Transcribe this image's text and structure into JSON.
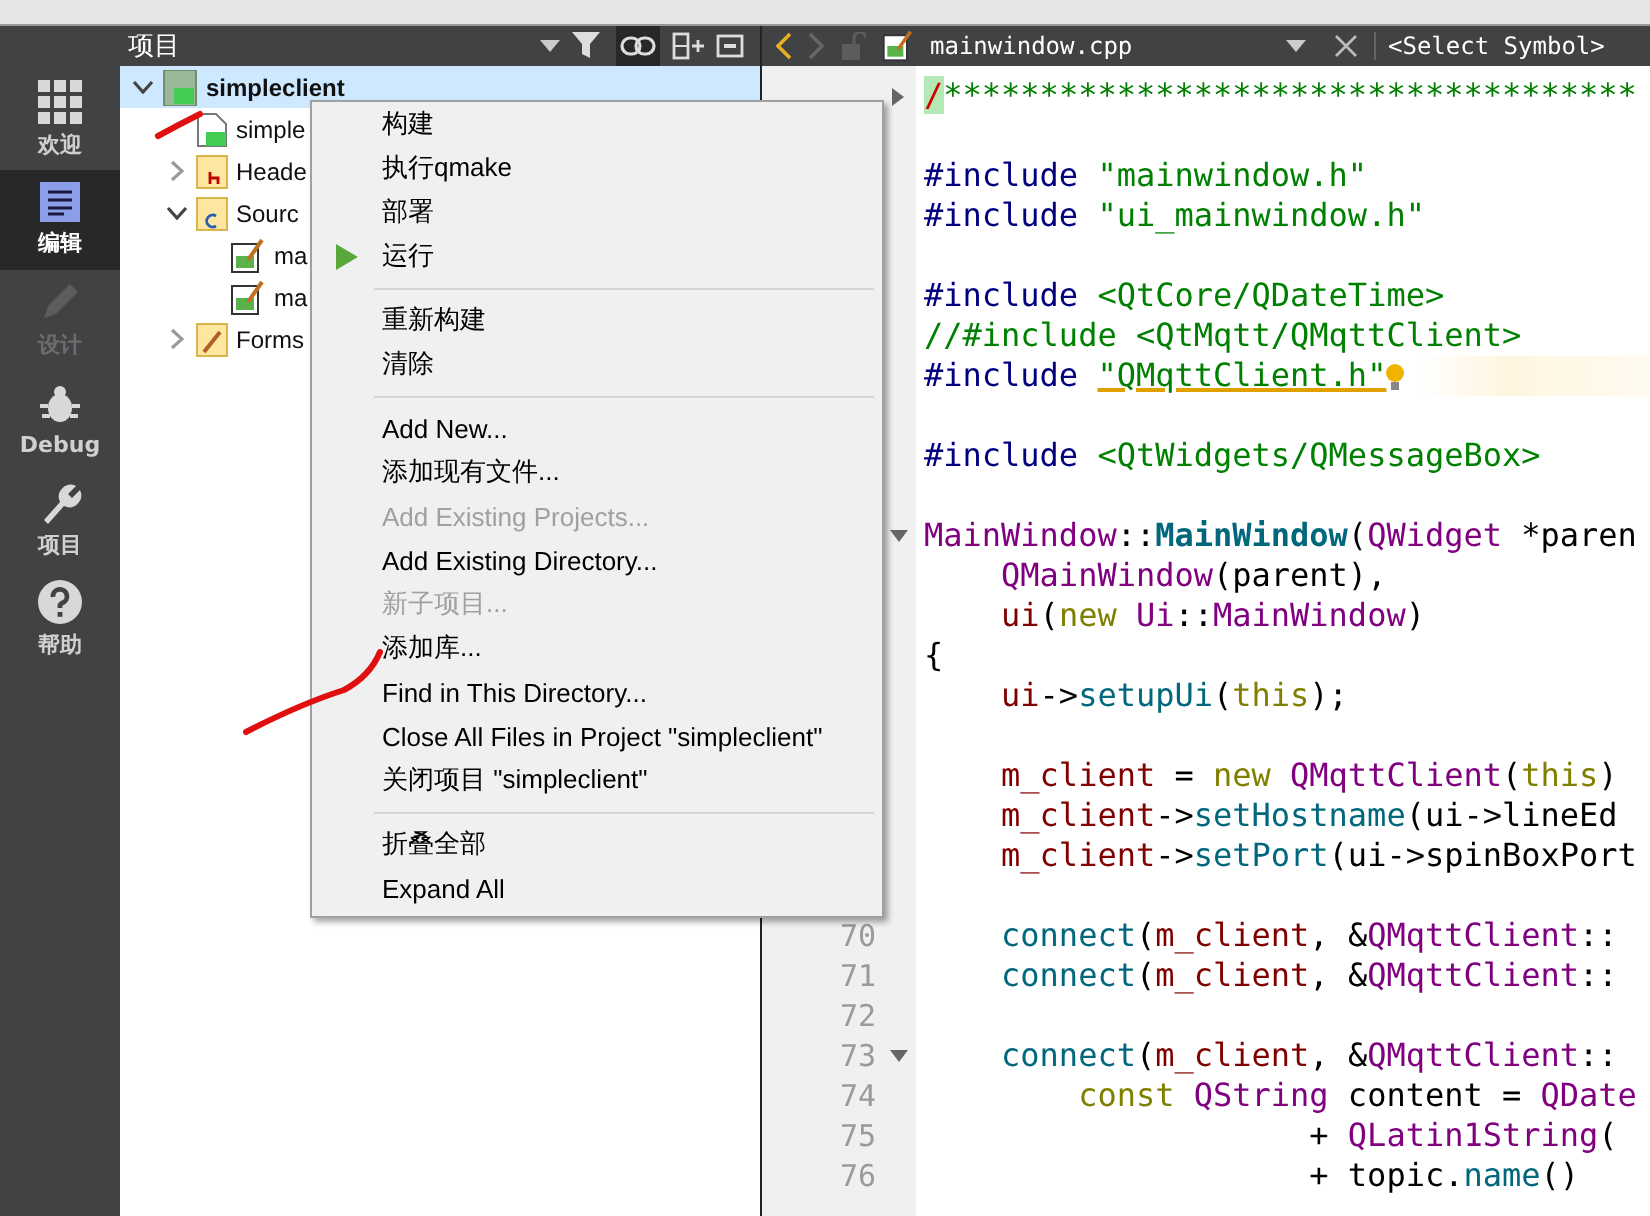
{
  "sidebar": {
    "modes": [
      {
        "label": "欢迎",
        "kind": "welcome",
        "selected": false,
        "disabled": false
      },
      {
        "label": "编辑",
        "kind": "edit",
        "selected": true,
        "disabled": false
      },
      {
        "label": "设计",
        "kind": "design",
        "selected": false,
        "disabled": true
      },
      {
        "label": "Debug",
        "kind": "debug",
        "selected": false,
        "disabled": false
      },
      {
        "label": "项目",
        "kind": "projects",
        "selected": false,
        "disabled": false
      },
      {
        "label": "帮助",
        "kind": "help",
        "selected": false,
        "disabled": false
      }
    ]
  },
  "project_panel": {
    "title": "项目",
    "tree": [
      {
        "label": "simpleclient",
        "kind": "project",
        "expanded": true,
        "selected": true,
        "children": [
          {
            "label": "simple",
            "kind": "pro",
            "selected": false
          },
          {
            "label": "Heade",
            "kind": "headers",
            "expanded": false,
            "selected": false
          },
          {
            "label": "Sourc",
            "kind": "sources",
            "expanded": true,
            "selected": false,
            "children": [
              {
                "label": "ma",
                "kind": "file",
                "selected": false
              },
              {
                "label": "ma",
                "kind": "file",
                "selected": false
              }
            ]
          },
          {
            "label": "Forms",
            "kind": "forms",
            "expanded": false,
            "selected": false
          }
        ]
      }
    ]
  },
  "editor": {
    "file": "mainwindow.cpp",
    "symbol": "<Select Symbol>",
    "blocks": [
      {
        "lines": [
          {
            "folded": true,
            "segments": [
              {
                "text": "/",
                "kind": "match"
              },
              {
                "text": "************************************",
                "kind": "comment"
              }
            ]
          }
        ]
      },
      {
        "lines": [
          {
            "segments": [
              {
                "text": "#include ",
                "kind": "pre"
              },
              {
                "text": "\"mainwindow.h\"",
                "kind": "string"
              }
            ]
          },
          {
            "segments": [
              {
                "text": "#include ",
                "kind": "pre"
              },
              {
                "text": "\"ui_mainwindow.h\"",
                "kind": "string"
              }
            ]
          }
        ]
      },
      {
        "lines": [
          {
            "segments": [
              {
                "text": "#include ",
                "kind": "pre"
              },
              {
                "text": "<QtCore/QDateTime>",
                "kind": "string"
              }
            ]
          },
          {
            "segments": [
              {
                "text": "//#include <QtMqtt/QMqttClient>",
                "kind": "comment"
              }
            ]
          },
          {
            "warning": true,
            "segments": [
              {
                "text": "#include ",
                "kind": "pre"
              },
              {
                "text": "\"QMqttClient.h\"",
                "kind": "warn"
              }
            ]
          }
        ]
      },
      {
        "lines": [
          {
            "segments": [
              {
                "text": "#include ",
                "kind": "pre"
              },
              {
                "text": "<QtWidgets/QMessageBox>",
                "kind": "string"
              }
            ]
          }
        ]
      },
      {
        "lines": [
          {
            "folded": false,
            "segments": [
              {
                "text": "MainWindow",
                "kind": "type"
              },
              {
                "text": "::",
                "kind": "plain"
              },
              {
                "text": "MainWindow",
                "kind": "def"
              },
              {
                "text": "(",
                "kind": "plain"
              },
              {
                "text": "QWidget",
                "kind": "type"
              },
              {
                "text": " *paren",
                "kind": "plain"
              }
            ]
          },
          {
            "segments": [
              {
                "text": "    QMainWindow",
                "kind": "type"
              },
              {
                "text": "(parent),",
                "kind": "plain"
              }
            ]
          },
          {
            "segments": [
              {
                "text": "    ui",
                "kind": "member"
              },
              {
                "text": "(",
                "kind": "plain"
              },
              {
                "text": "new ",
                "kind": "keyword"
              },
              {
                "text": "Ui",
                "kind": "type"
              },
              {
                "text": "::",
                "kind": "plain"
              },
              {
                "text": "MainWindow",
                "kind": "type"
              },
              {
                "text": ")",
                "kind": "plain"
              }
            ]
          },
          {
            "segments": [
              {
                "text": "{",
                "kind": "plain"
              }
            ]
          },
          {
            "segments": [
              {
                "text": "    ui",
                "kind": "member"
              },
              {
                "text": "->",
                "kind": "plain"
              },
              {
                "text": "setupUi",
                "kind": "func"
              },
              {
                "text": "(",
                "kind": "plain"
              },
              {
                "text": "this",
                "kind": "keyword"
              },
              {
                "text": ");",
                "kind": "plain"
              }
            ]
          }
        ]
      },
      {
        "lines": [
          {
            "segments": [
              {
                "text": "    m_client",
                "kind": "member"
              },
              {
                "text": " = ",
                "kind": "plain"
              },
              {
                "text": "new ",
                "kind": "keyword"
              },
              {
                "text": "QMqttClient",
                "kind": "type"
              },
              {
                "text": "(",
                "kind": "plain"
              },
              {
                "text": "this",
                "kind": "keyword"
              },
              {
                "text": ")",
                "kind": "plain"
              }
            ]
          },
          {
            "segments": [
              {
                "text": "    m_client",
                "kind": "member"
              },
              {
                "text": "->",
                "kind": "plain"
              },
              {
                "text": "setHostname",
                "kind": "func"
              },
              {
                "text": "(ui->lineEd",
                "kind": "plain"
              }
            ]
          },
          {
            "segments": [
              {
                "text": "    m_client",
                "kind": "member"
              },
              {
                "text": "->",
                "kind": "plain"
              },
              {
                "text": "setPort",
                "kind": "func"
              },
              {
                "text": "(ui->spinBoxPort",
                "kind": "plain"
              }
            ]
          }
        ]
      },
      {
        "lines": [
          {
            "number": "70",
            "segments": [
              {
                "text": "    connect",
                "kind": "func"
              },
              {
                "text": "(",
                "kind": "plain"
              },
              {
                "text": "m_client",
                "kind": "member"
              },
              {
                "text": ", &",
                "kind": "plain"
              },
              {
                "text": "QMqttClient",
                "kind": "type"
              },
              {
                "text": "::",
                "kind": "plain"
              }
            ]
          },
          {
            "number": "71",
            "segments": [
              {
                "text": "    connect",
                "kind": "func"
              },
              {
                "text": "(",
                "kind": "plain"
              },
              {
                "text": "m_client",
                "kind": "member"
              },
              {
                "text": ", &",
                "kind": "plain"
              },
              {
                "text": "QMqttClient",
                "kind": "type"
              },
              {
                "text": "::",
                "kind": "plain"
              }
            ]
          }
        ]
      },
      {
        "gap_number": "72",
        "lines": [
          {
            "number": "73",
            "folded": false,
            "segments": [
              {
                "text": "    connect",
                "kind": "func"
              },
              {
                "text": "(",
                "kind": "plain"
              },
              {
                "text": "m_client",
                "kind": "member"
              },
              {
                "text": ", &",
                "kind": "plain"
              },
              {
                "text": "QMqttClient",
                "kind": "type"
              },
              {
                "text": "::",
                "kind": "plain"
              }
            ]
          },
          {
            "number": "74",
            "segments": [
              {
                "text": "        const ",
                "kind": "keyword"
              },
              {
                "text": "QString",
                "kind": "type"
              },
              {
                "text": " content = ",
                "kind": "plain"
              },
              {
                "text": "QDate",
                "kind": "type"
              }
            ]
          },
          {
            "number": "75",
            "segments": [
              {
                "text": "                    + ",
                "kind": "plain"
              },
              {
                "text": "QLatin1String",
                "kind": "type"
              },
              {
                "text": "(",
                "kind": "plain"
              }
            ]
          },
          {
            "number": "76",
            "segments": [
              {
                "text": "                    + topic.",
                "kind": "plain"
              },
              {
                "text": "name",
                "kind": "func"
              },
              {
                "text": "()",
                "kind": "plain"
              }
            ]
          }
        ]
      }
    ]
  },
  "context_menu": {
    "sections": [
      [
        {
          "label": "构建",
          "kind": "plain",
          "disabled": false
        },
        {
          "label": "执行qmake",
          "kind": "plain",
          "disabled": false
        },
        {
          "label": "部署",
          "kind": "plain",
          "disabled": false
        },
        {
          "label": "运行",
          "kind": "run",
          "disabled": false
        }
      ],
      [
        {
          "label": "重新构建",
          "kind": "plain",
          "disabled": false
        },
        {
          "label": "清除",
          "kind": "plain",
          "disabled": false
        }
      ],
      [
        {
          "label": "Add New...",
          "kind": "plain",
          "disabled": false
        },
        {
          "label": "添加现有文件...",
          "kind": "plain",
          "disabled": false
        },
        {
          "label": "Add Existing Projects...",
          "kind": "plain",
          "disabled": true
        },
        {
          "label": "Add Existing Directory...",
          "kind": "plain",
          "disabled": false
        },
        {
          "label": "新子项目...",
          "kind": "plain",
          "disabled": true
        },
        {
          "label": "添加库...",
          "kind": "plain",
          "disabled": false
        },
        {
          "label": "Find in This Directory...",
          "kind": "plain",
          "disabled": false
        },
        {
          "label": "Close All Files in Project \"simpleclient\"",
          "kind": "plain",
          "disabled": false
        },
        {
          "label": "关闭项目 \"simpleclient\"",
          "kind": "plain",
          "disabled": false
        }
      ],
      [
        {
          "label": "折叠全部",
          "kind": "plain",
          "disabled": false
        },
        {
          "label": "Expand All",
          "kind": "plain",
          "disabled": false
        }
      ]
    ]
  }
}
